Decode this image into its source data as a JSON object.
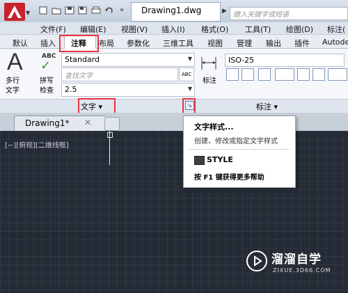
{
  "window": {
    "document_title": "Drawing1.dwg",
    "search_placeholder": "键入关键字或短语"
  },
  "menu": [
    "文件(F)",
    "编辑(E)",
    "视图(V)",
    "插入(I)",
    "格式(O)",
    "工具(T)",
    "绘图(D)",
    "标注("
  ],
  "ribbon_tabs": [
    "默认",
    "插入",
    "注释",
    "布局",
    "参数化",
    "三维工具",
    "视图",
    "管理",
    "输出",
    "插件",
    "Autode"
  ],
  "active_ribbon_tab": "注释",
  "text_panel": {
    "mtext_label_1": "多行",
    "mtext_label_2": "文字",
    "abc": "ABC",
    "spell_label_1": "拼写",
    "spell_label_2": "检查",
    "text_style": "Standard",
    "find_placeholder": "查找文字",
    "text_height": "2.5",
    "panel_title": "文字 ▾"
  },
  "dimension_panel": {
    "dim_label": "标注",
    "dim_style": "ISO-25",
    "panel_title": "标注 ▾"
  },
  "file_tab": {
    "label": "Drawing1*",
    "close": "✕"
  },
  "viewport": {
    "label": "[−][俯视][二维线框]"
  },
  "tooltip": {
    "title": "文字样式...",
    "description": "创建、修改或指定文字样式",
    "command": "STYLE",
    "help": "按 F1 键获得更多帮助"
  },
  "watermark": {
    "title": "溜溜自学",
    "url": "ZIXUE.3D66.COM"
  },
  "colors": {
    "highlight": "#e8343f",
    "canvas": "#252b35",
    "logo_red": "#c8232c"
  }
}
